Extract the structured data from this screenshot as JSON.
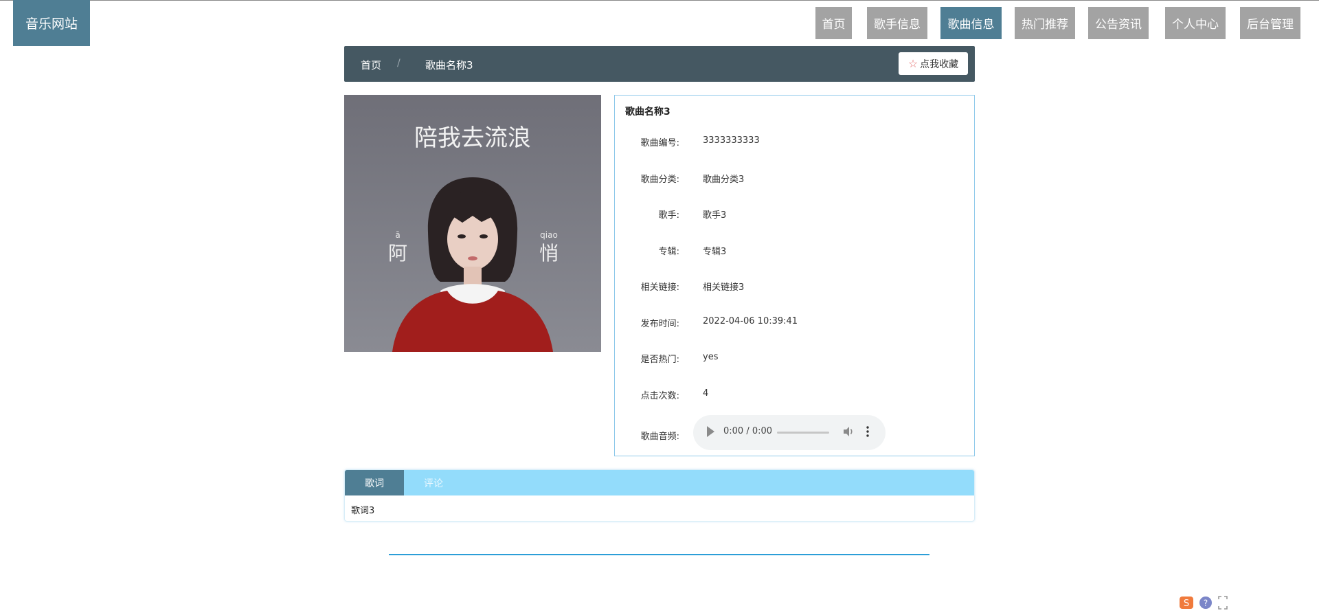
{
  "site": {
    "logo": "音乐网站"
  },
  "nav": {
    "items": [
      {
        "label": "首页",
        "active": false
      },
      {
        "label": "歌手信息",
        "active": false
      },
      {
        "label": "歌曲信息",
        "active": true
      },
      {
        "label": "热门推荐",
        "active": false
      },
      {
        "label": "公告资讯",
        "active": false
      },
      {
        "label": "个人中心",
        "active": false
      },
      {
        "label": "后台管理",
        "active": false
      }
    ]
  },
  "breadcrumb": {
    "home": "首页",
    "separator": "/",
    "current": "歌曲名称3",
    "favorite_label": "点我收藏",
    "favorite_icon": "star-outline"
  },
  "cover": {
    "title_text": "陪我去流浪",
    "left_char": "阿",
    "left_pinyin": "ā",
    "right_char": "悄",
    "right_pinyin": "qiao"
  },
  "song": {
    "title": "歌曲名称3",
    "fields": [
      {
        "label": "歌曲编号:",
        "value": "3333333333"
      },
      {
        "label": "歌曲分类:",
        "value": "歌曲分类3"
      },
      {
        "label": "歌手:",
        "value": "歌手3"
      },
      {
        "label": "专辑:",
        "value": "专辑3"
      },
      {
        "label": "相关链接:",
        "value": "相关链接3"
      },
      {
        "label": "发布时间:",
        "value": "2022-04-06 10:39:41"
      },
      {
        "label": "是否热门:",
        "value": "yes"
      },
      {
        "label": "点击次数:",
        "value": "4"
      }
    ],
    "audio_label": "歌曲音频:",
    "audio_time": "0:00 / 0:00"
  },
  "tabs": {
    "items": [
      {
        "label": "歌词",
        "active": true
      },
      {
        "label": "评论",
        "active": false
      }
    ],
    "content": "歌词3"
  },
  "colors": {
    "accent": "#4f7e94",
    "nav_inactive": "#a3a3a3",
    "breadcrumb_bg": "#455862",
    "tab_bar": "#93dcfb",
    "divider": "#2c9ed8"
  }
}
